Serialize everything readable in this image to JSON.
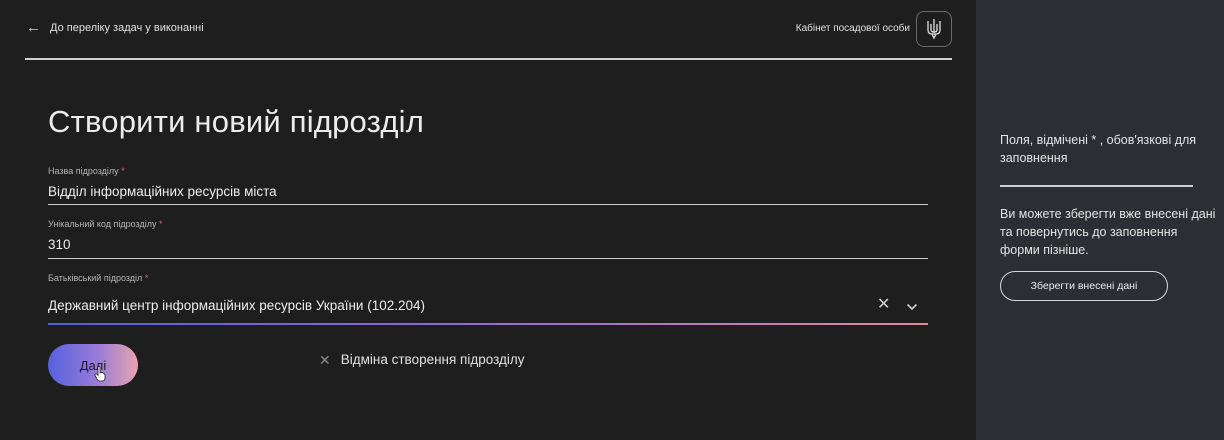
{
  "header": {
    "back_label": "До переліку задач у виконанні",
    "cabinet_label": "Кабінет посадової особи",
    "emblem_icon": "trident-icon"
  },
  "form": {
    "title": "Створити новий підрозділ",
    "fields": [
      {
        "label": "Назва підрозділу",
        "required_mark": "*",
        "value": "Відділ інформаційних ресурсів міста"
      },
      {
        "label": "Унікальний код підрозділу",
        "required_mark": "*",
        "value": "310"
      },
      {
        "label": "Батьківський підрозділ",
        "required_mark": "*",
        "value": "Державний центр інформаційних ресурсів України (102.204)"
      }
    ],
    "clear_icon": "close-icon",
    "dropdown_icon": "chevron-down-icon",
    "next_label": "Далі",
    "cancel_label": "Відміна створення підрозділу"
  },
  "side": {
    "required_note": "Поля, відмічені * , обов'язкові для заповнення",
    "save_note": "Ви можете зберегти вже внесені дані та повернутись до заповнення форми пізніше.",
    "save_label": "Зберегти внесені дані"
  },
  "colors": {
    "background": "#1e1e1e",
    "side_panel": "#2b2f33",
    "accent_gradient_start": "#5562e0",
    "accent_gradient_end": "#e6a4b0",
    "required": "#e0626b"
  }
}
